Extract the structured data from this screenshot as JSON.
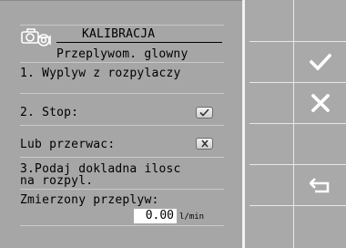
{
  "screen": {
    "title": "KALIBRACJA",
    "subtitle": "Przeplywom. glowny",
    "step1": "1. Wyplyw z rozpylaczy",
    "stop_label": "2. Stop:",
    "interrupt_label": "Lub przerwac:",
    "step3_line1": "3.Podaj dokladna ilosc",
    "step3_line2": "na rozpyl.",
    "measured_label": "Zmierzony przeplyw:",
    "measured_value": "0.00",
    "measured_unit": "l/min"
  },
  "softkeys": {
    "icons": [
      "confirm-check-icon",
      "cancel-x-icon",
      "return-arrow-icon"
    ]
  },
  "colors": {
    "panel": "#a6a6a6",
    "softkey_panel": "#a9a9a9",
    "divider": "#e8e8e8",
    "value_box": "#ffffff"
  }
}
